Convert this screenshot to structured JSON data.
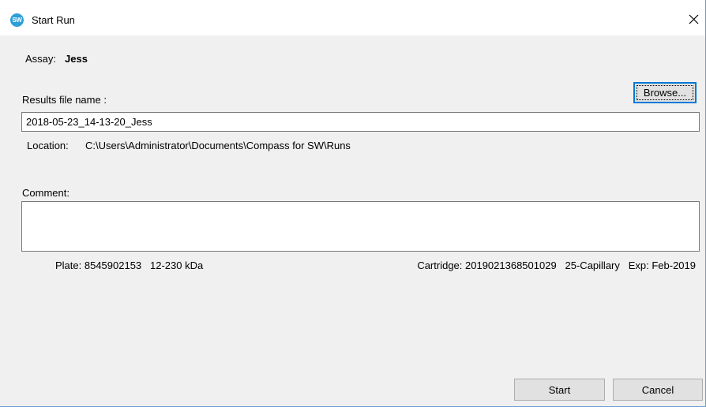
{
  "window": {
    "title": "Start Run",
    "icon": "sw-app-icon",
    "icon_text": "SW",
    "close_icon": "close-icon"
  },
  "assay": {
    "label": "Assay:",
    "value": "Jess"
  },
  "results": {
    "label": "Results file name :",
    "value": "2018-05-23_14-13-20_Jess",
    "browse_label": "Browse..."
  },
  "location": {
    "label": "Location:",
    "value": "C:\\Users\\Administrator\\Documents\\Compass for SW\\Runs"
  },
  "comment": {
    "label": "Comment:",
    "value": ""
  },
  "plate": {
    "text": "Plate: 8545902153   12-230 kDa"
  },
  "cartridge": {
    "text": "Cartridge: 2019021368501029   25-Capillary   Exp: Feb-2019"
  },
  "actions": {
    "start_label": "Start",
    "cancel_label": "Cancel"
  },
  "colors": {
    "window_bg": "#f0f0f0",
    "titlebar_bg": "#ffffff",
    "focus_border": "#0078d7",
    "app_icon": "#2d9fd6"
  }
}
